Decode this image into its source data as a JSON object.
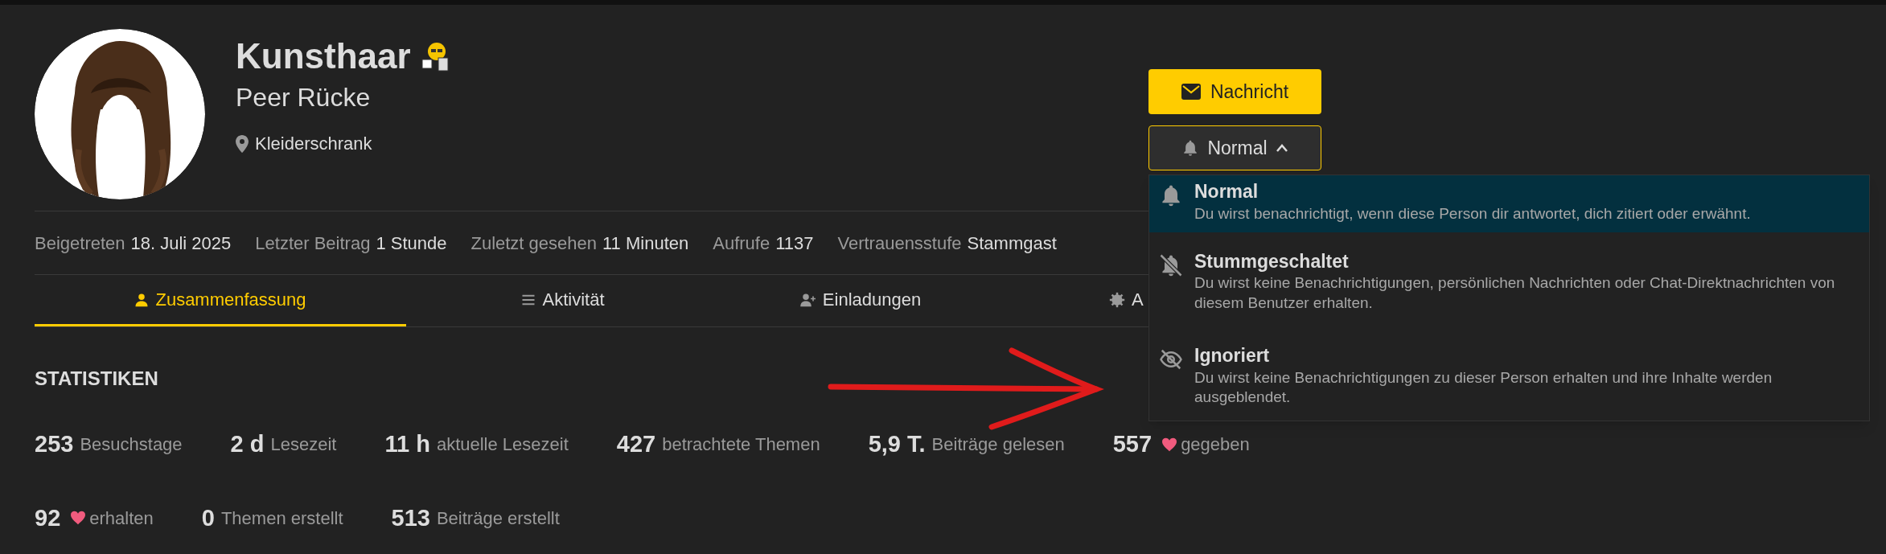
{
  "profile": {
    "username": "Kunsthaar",
    "full_name": "Peer Rücke",
    "location": "Kleiderschrank"
  },
  "actions": {
    "message_button": "Nachricht",
    "notification_button": {
      "label": "Normal",
      "expanded": true
    }
  },
  "notification_menu": [
    {
      "kind": "normal",
      "title": "Normal",
      "description": "Du wirst benachrichtigt, wenn diese Person dir antwortet, dich zitiert oder erwähnt.",
      "selected": true
    },
    {
      "kind": "muted",
      "title": "Stummgeschaltet",
      "description": "Du wirst keine Benachrichtigungen, persönlichen Nachrichten oder Chat-Direktnachrichten von diesem Benutzer erhalten.",
      "selected": false
    },
    {
      "kind": "ignored",
      "title": "Ignoriert",
      "description": "Du wirst keine Benachrichtigungen zu dieser Person erhalten und ihre Inhalte werden ausgeblendet.",
      "selected": false
    }
  ],
  "meta": [
    {
      "label": "Beigetreten",
      "value": "18. Juli 2025"
    },
    {
      "label": "Letzter Beitrag",
      "value": "1 Stunde"
    },
    {
      "label": "Zuletzt gesehen",
      "value": "11 Minuten"
    },
    {
      "label": "Aufrufe",
      "value": "1137"
    },
    {
      "label": "Vertrauensstufe",
      "value": "Stammgast"
    }
  ],
  "tabs": [
    {
      "kind": "user",
      "label": "Zusammenfassung",
      "selected": true
    },
    {
      "kind": "list",
      "label": "Aktivität",
      "selected": false
    },
    {
      "kind": "invite",
      "label": "Einladungen",
      "selected": false
    },
    {
      "kind": "badge",
      "label": "A",
      "selected": false
    }
  ],
  "statistics": {
    "title": "STATISTIKEN",
    "rows": [
      [
        {
          "value": "253",
          "label": "Besuchstage",
          "kind": "plain"
        },
        {
          "value": "2 d",
          "label": "Lesezeit",
          "kind": "plain"
        },
        {
          "value": "11 h",
          "label": "aktuelle Lesezeit",
          "kind": "plain"
        },
        {
          "value": "427",
          "label": "betrachtete Themen",
          "kind": "plain"
        },
        {
          "value": "5,9 T.",
          "label": "Beiträge gelesen",
          "kind": "plain"
        },
        {
          "value": "557",
          "label": "gegeben",
          "kind": "heart"
        }
      ],
      [
        {
          "value": "92",
          "label": "erhalten",
          "kind": "heart"
        },
        {
          "value": "0",
          "label": "Themen erstellt",
          "kind": "plain"
        },
        {
          "value": "513",
          "label": "Beiträge erstellt",
          "kind": "plain"
        }
      ]
    ]
  }
}
